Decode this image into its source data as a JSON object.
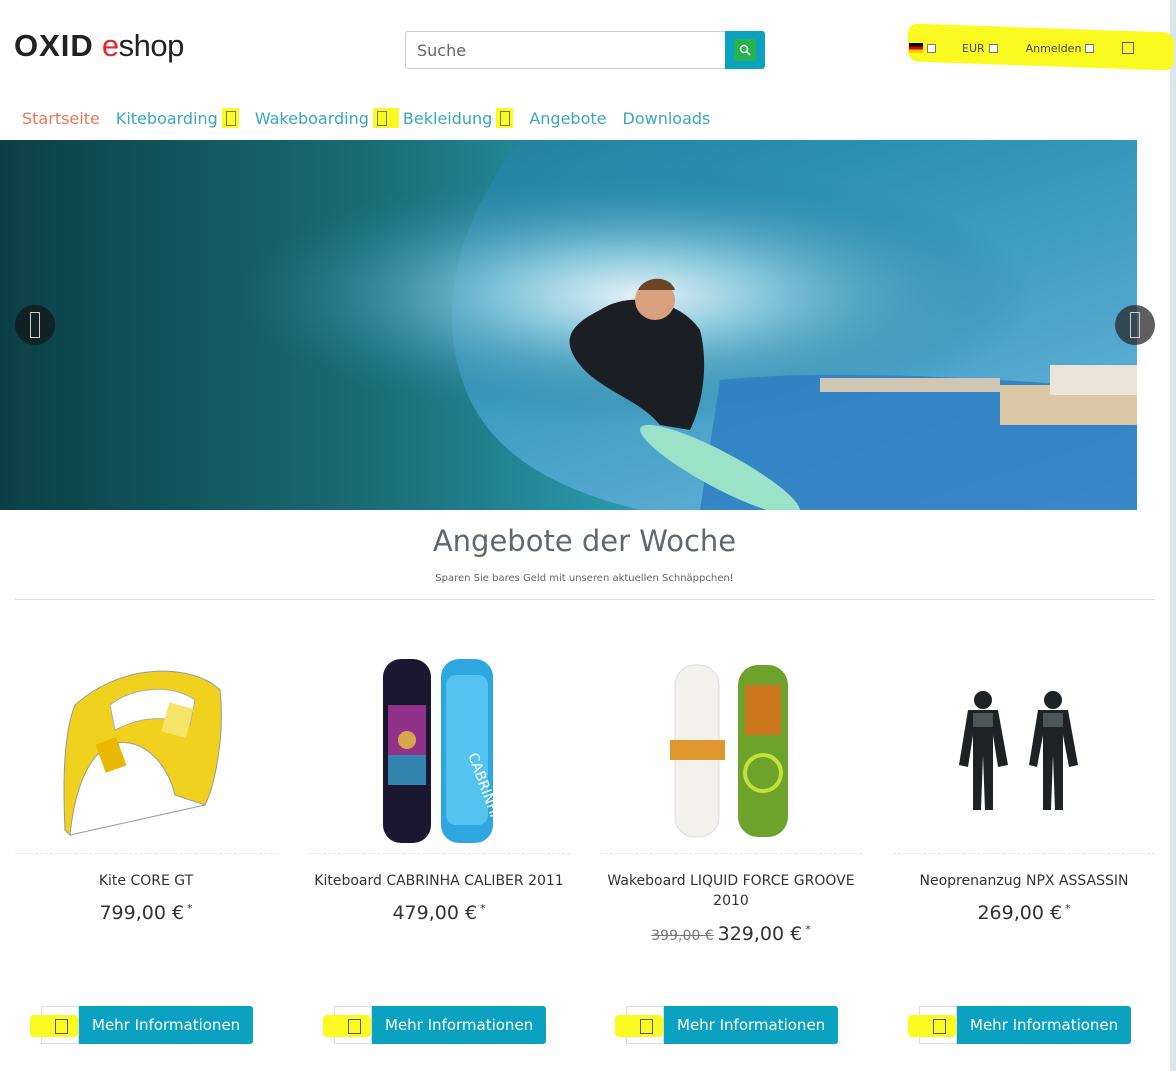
{
  "logo": {
    "part1": "OXID",
    "part2": "e",
    "part3": "shop"
  },
  "search": {
    "placeholder": "Suche"
  },
  "topbar": {
    "currency": "EUR",
    "login": "Anmelden"
  },
  "nav": [
    {
      "label": "Startseite",
      "active": true
    },
    {
      "label": "Kiteboarding"
    },
    {
      "label": "Wakeboarding"
    },
    {
      "label": "Bekleidung"
    },
    {
      "label": "Angebote"
    },
    {
      "label": "Downloads"
    }
  ],
  "section": {
    "title": "Angebote der Woche",
    "subtitle": "Sparen Sie bares Geld mit unseren aktuellen Schnäppchen!"
  },
  "products": [
    {
      "name": "Kite CORE GT",
      "price": "799,00 €",
      "asterisk": "*",
      "button": "Mehr Informationen"
    },
    {
      "name": "Kiteboard CABRINHA CALIBER 2011",
      "price": "479,00 €",
      "asterisk": "*",
      "button": "Mehr Informationen"
    },
    {
      "name": "Wakeboard LIQUID FORCE GROOVE 2010",
      "old_price": "399,00 €",
      "price": "329,00 €",
      "asterisk": "*",
      "button": "Mehr Informationen"
    },
    {
      "name": "Neoprenanzug NPX ASSASSIN",
      "price": "269,00 €",
      "asterisk": "*",
      "button": "Mehr Informationen"
    }
  ],
  "colors": {
    "accent": "#0aa2c0",
    "nav_link": "#38a7bf",
    "nav_active": "#e8765a",
    "highlight": "#fbfb22"
  }
}
